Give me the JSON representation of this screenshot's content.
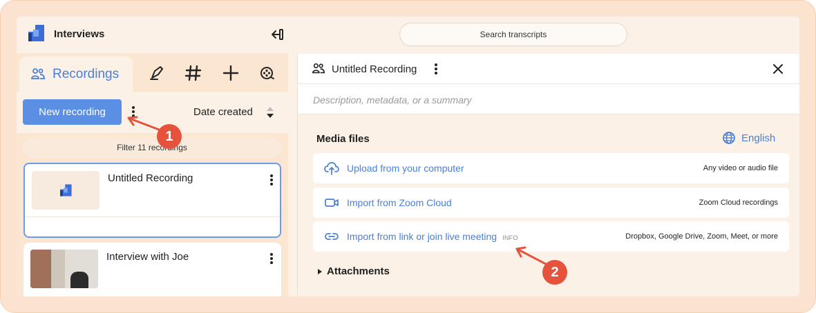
{
  "app": {
    "title": "Interviews",
    "brand_color": "#3b6fd6"
  },
  "search": {
    "placeholder": "Search transcripts"
  },
  "left_panel": {
    "tabs": [
      {
        "label": "Recordings",
        "icon": "users-icon",
        "active": true
      },
      {
        "label": "",
        "icon": "highlighter-icon"
      },
      {
        "label": "",
        "icon": "hashtag-icon"
      },
      {
        "label": "",
        "icon": "plus-icon"
      },
      {
        "label": "",
        "icon": "film-reel-icon"
      }
    ],
    "new_recording_label": "New recording",
    "sort_label": "Date created",
    "filter_label": "Filter 11 recordings",
    "recordings": [
      {
        "title": "Untitled Recording",
        "selected": true
      },
      {
        "title": "Interview with Joe",
        "selected": false
      }
    ]
  },
  "right_panel": {
    "title": "Untitled Recording",
    "description_placeholder": "Description, metadata, or a summary",
    "media_files_title": "Media files",
    "language": "English",
    "media_options": [
      {
        "label": "Upload from your computer",
        "info": "",
        "detail": "Any video or audio file",
        "icon": "cloud-upload-icon"
      },
      {
        "label": "Import from Zoom Cloud",
        "info": "",
        "detail": "Zoom Cloud recordings",
        "icon": "video-camera-icon"
      },
      {
        "label": "Import from link or join live meeting",
        "info": "INFO",
        "detail": "Dropbox, Google Drive, Zoom, Meet, or more",
        "icon": "link-icon"
      }
    ],
    "attachments_label": "Attachments"
  },
  "annotations": [
    {
      "number": "1"
    },
    {
      "number": "2"
    }
  ],
  "colors": {
    "accent": "#4a7fd6",
    "button": "#5a8fe4",
    "annotation": "#e5533d"
  }
}
